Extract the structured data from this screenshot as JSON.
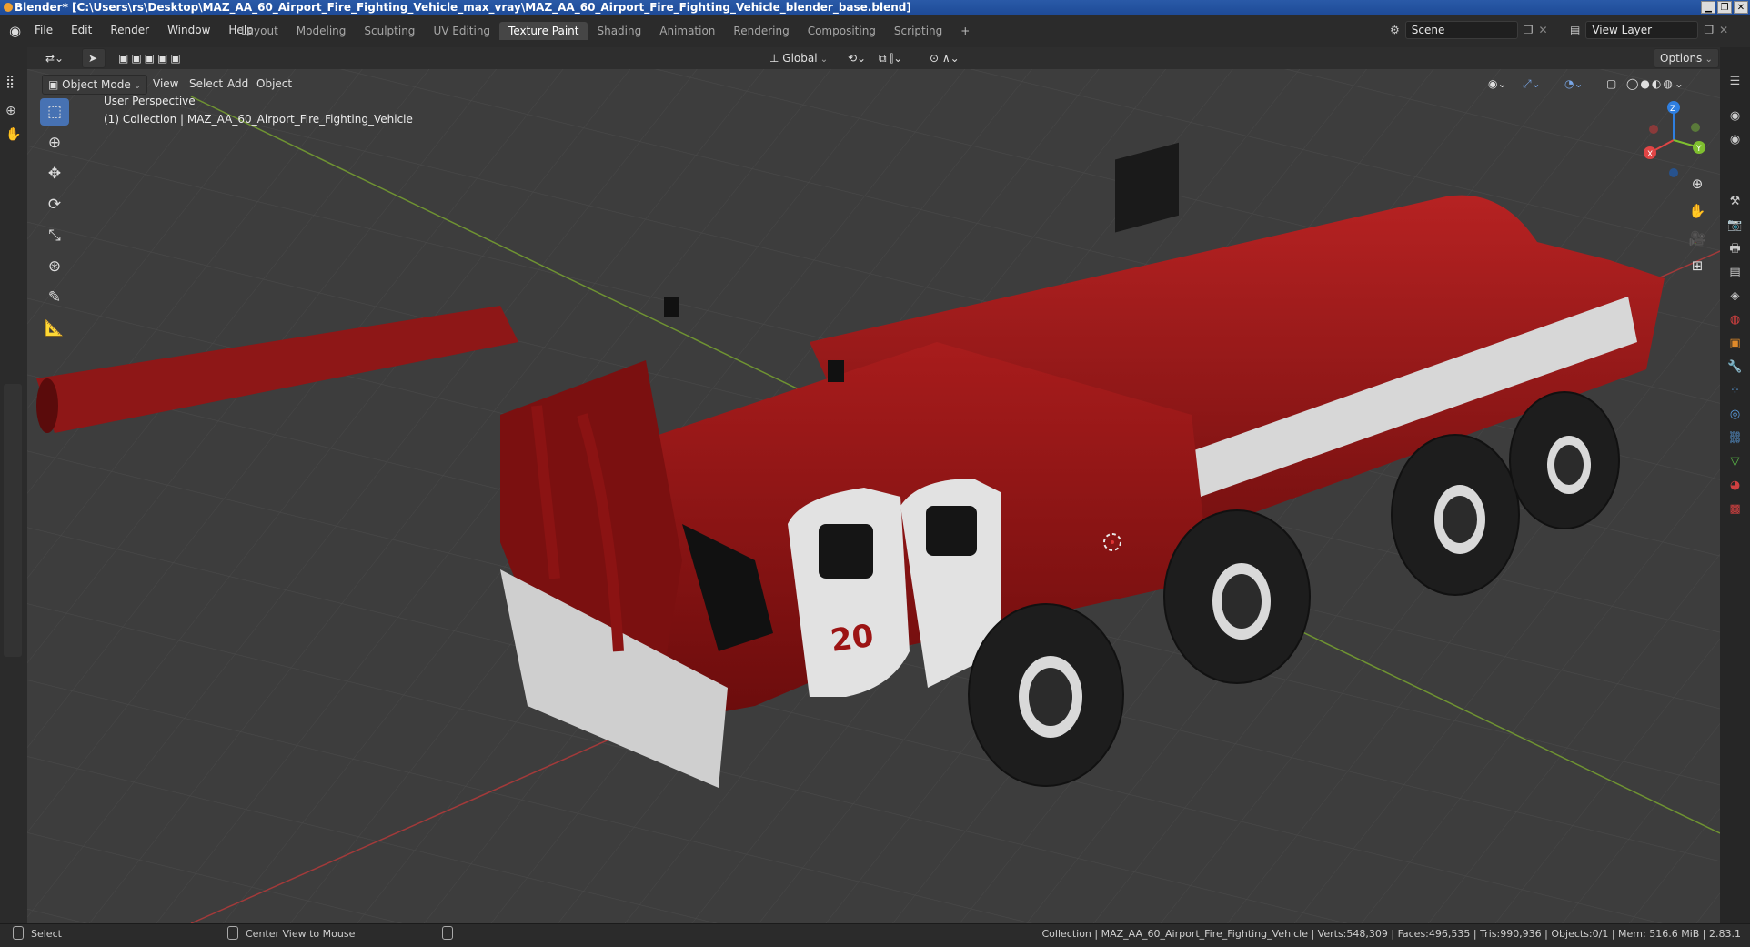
{
  "window": {
    "title": "Blender* [C:\\Users\\rs\\Desktop\\MAZ_AA_60_Airport_Fire_Fighting_Vehicle_max_vray\\MAZ_AA_60_Airport_Fire_Fighting_Vehicle_blender_base.blend]",
    "minimize": "▁",
    "maximize": "❐",
    "close": "✕"
  },
  "menu": [
    "File",
    "Edit",
    "Render",
    "Window",
    "Help"
  ],
  "workspaces": [
    "Layout",
    "Modeling",
    "Sculpting",
    "UV Editing",
    "Texture Paint",
    "Shading",
    "Animation",
    "Rendering",
    "Compositing",
    "Scripting"
  ],
  "active_workspace": "Texture Paint",
  "add_workspace": "+",
  "scene": {
    "label": "Scene",
    "view_layer": "View Layer"
  },
  "header": {
    "transform_orientation": "Global",
    "options": "Options"
  },
  "view_header": {
    "mode": "Object Mode",
    "menus": [
      "View",
      "Select",
      "Add",
      "Object"
    ]
  },
  "viewport": {
    "perspective": "User Perspective",
    "collection": "(1) Collection | MAZ_AA_60_Airport_Fire_Fighting_Vehicle",
    "unit_number": "20",
    "accent_red": "#8a1414",
    "grid_x_color": "#b33a3a",
    "grid_y_color": "#7aa133"
  },
  "gizmo": {
    "x": "X",
    "y": "Y",
    "z": "Z"
  },
  "status": {
    "left": "Select",
    "middle": "Center View to Mouse",
    "right": "Collection | MAZ_AA_60_Airport_Fire_Fighting_Vehicle | Verts:548,309 | Faces:496,535 | Tris:990,936 | Objects:0/1 | Mem: 516.6 MiB | 2.83.1"
  }
}
